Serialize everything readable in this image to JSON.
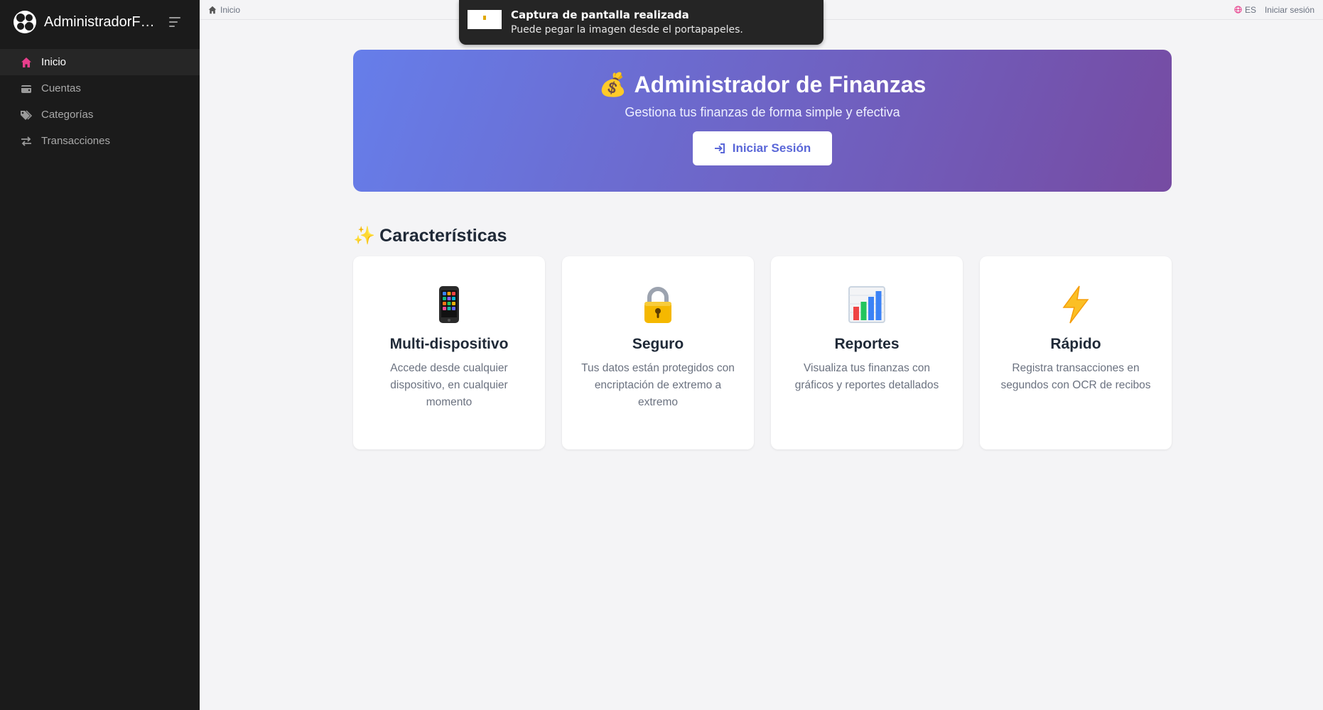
{
  "sidebar": {
    "brand": "AdministradorFin...",
    "items": [
      {
        "label": "Inicio",
        "icon": "home-icon",
        "active": true
      },
      {
        "label": "Cuentas",
        "icon": "wallet-icon",
        "active": false
      },
      {
        "label": "Categorías",
        "icon": "tags-icon",
        "active": false
      },
      {
        "label": "Transacciones",
        "icon": "transfer-icon",
        "active": false
      }
    ]
  },
  "topbar": {
    "breadcrumb": "Inicio",
    "language": "ES",
    "login": "Iniciar sesión"
  },
  "toast": {
    "title": "Captura de pantalla realizada",
    "message": "Puede pegar la imagen desde el portapapeles."
  },
  "hero": {
    "emoji": "💰",
    "title": "Administrador de Finanzas",
    "subtitle": "Gestiona tus finanzas de forma simple y efectiva",
    "button": "Iniciar Sesión"
  },
  "features": {
    "emoji": "✨",
    "title": "Características",
    "items": [
      {
        "icon": "mobile-phone-icon",
        "title": "Multi-dispositivo",
        "desc": "Accede desde cualquier dispositivo, en cualquier momento"
      },
      {
        "icon": "lock-icon",
        "title": "Seguro",
        "desc": "Tus datos están protegidos con encriptación de extremo a extremo"
      },
      {
        "icon": "bar-chart-icon",
        "title": "Reportes",
        "desc": "Visualiza tus finanzas con gráficos y reportes detallados"
      },
      {
        "icon": "lightning-icon",
        "title": "Rápido",
        "desc": "Registra transacciones en segundos con OCR de recibos"
      }
    ]
  },
  "colors": {
    "sidebar_bg": "#1b1b1b",
    "active_icon": "#e83e8c",
    "hero_start": "#667eea",
    "hero_end": "#764ba2",
    "button_text": "#5a67d8"
  }
}
